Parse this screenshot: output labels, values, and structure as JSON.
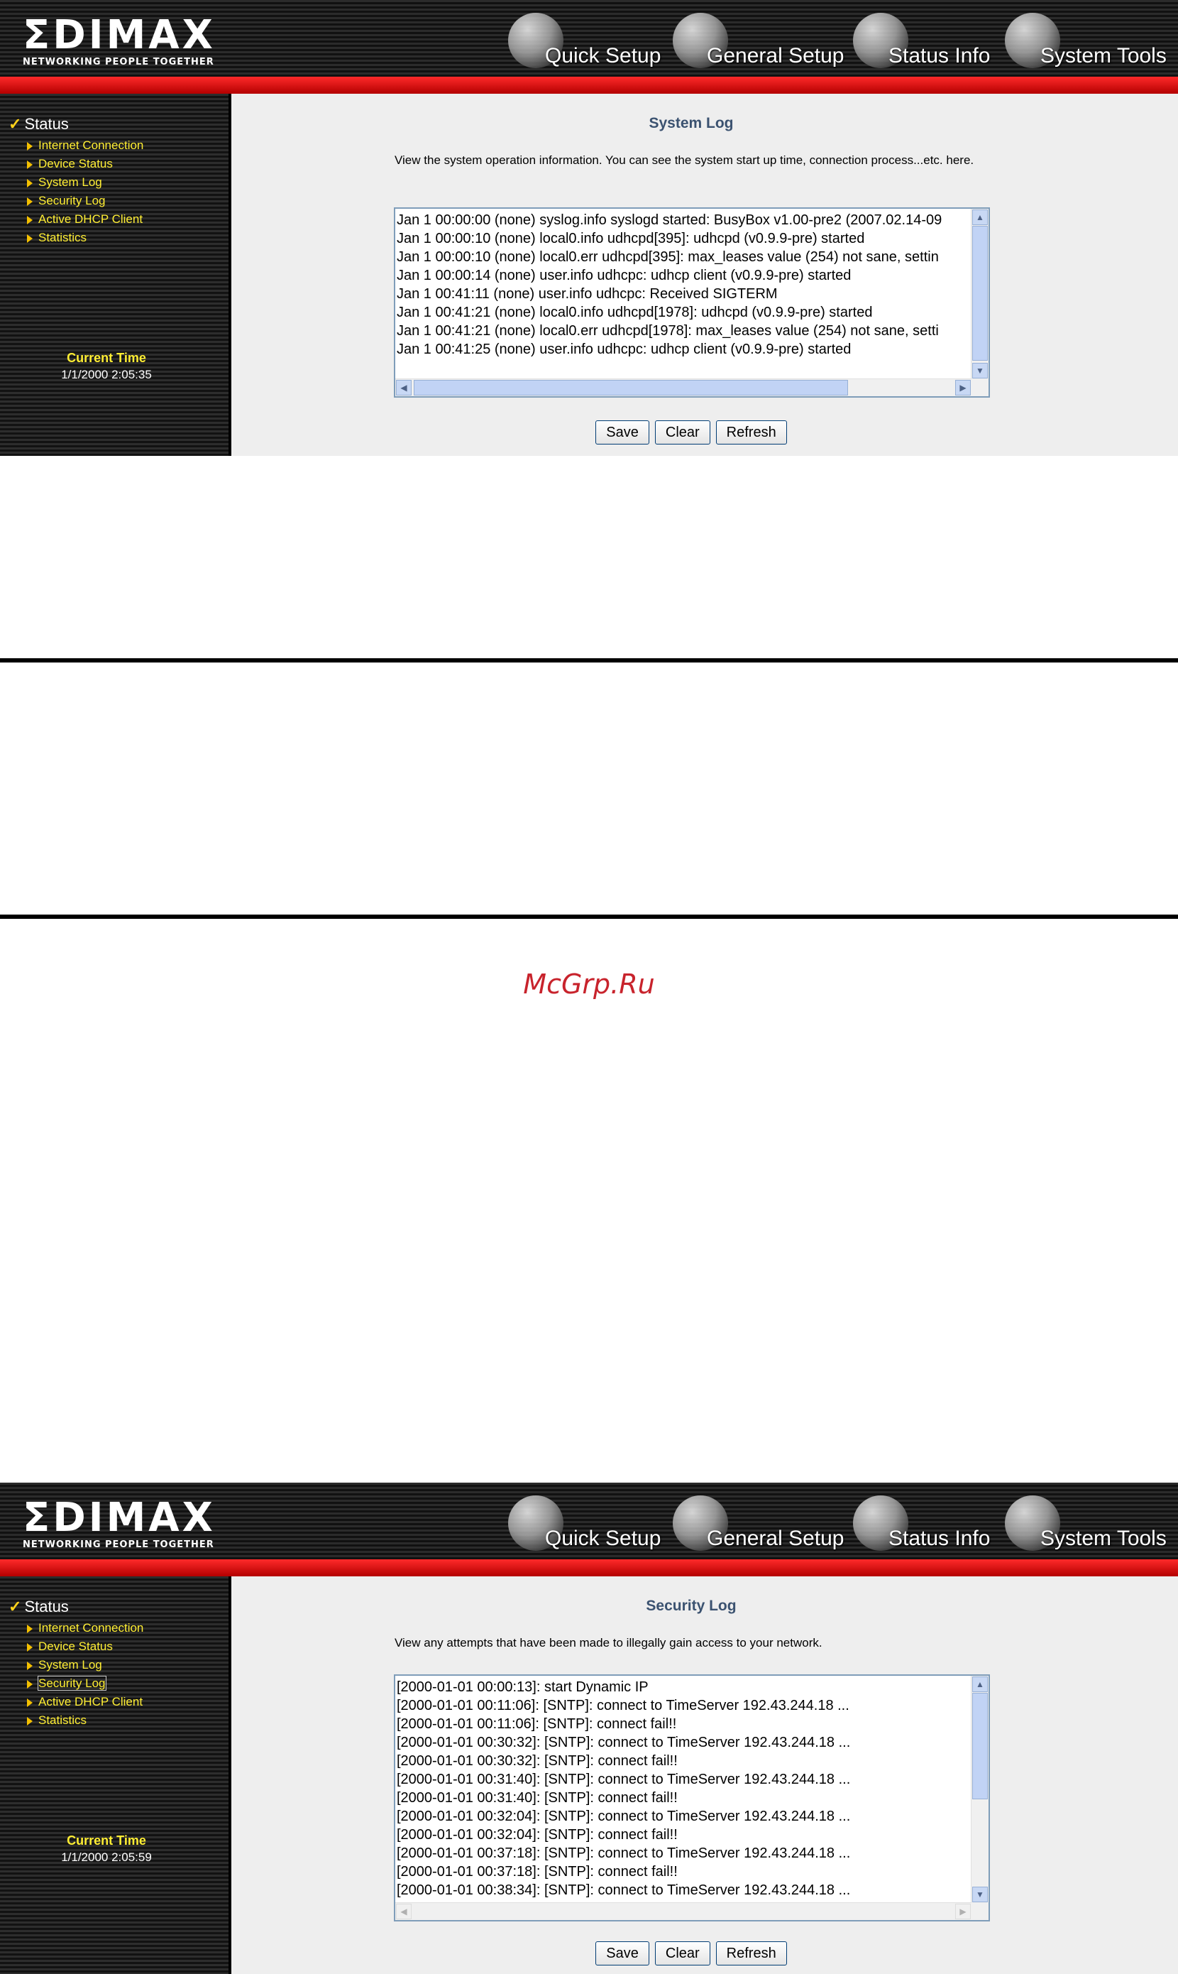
{
  "brand": {
    "name": "ΣDIMAX",
    "tagline": "NETWORKING PEOPLE TOGETHER"
  },
  "nav": [
    "Quick Setup",
    "General Setup",
    "Status Info",
    "System Tools"
  ],
  "sidebar": {
    "heading": "Status",
    "items": [
      "Internet Connection",
      "Device Status",
      "System Log",
      "Security Log",
      "Active DHCP Client",
      "Statistics"
    ],
    "time_label": "Current Time"
  },
  "buttons": {
    "save": "Save",
    "clear": "Clear",
    "refresh": "Refresh"
  },
  "system_log": {
    "current_time": "1/1/2000 2:05:35",
    "title": "System Log",
    "description": "View the system operation information. You can see the system start up time, connection process...etc. here.",
    "lines": [
      "Jan  1 00:00:00 (none) syslog.info syslogd started: BusyBox v1.00-pre2 (2007.02.14-09",
      "Jan  1 00:00:10 (none) local0.info udhcpd[395]: udhcpd (v0.9.9-pre) started",
      "Jan  1 00:00:10 (none) local0.err udhcpd[395]: max_leases value (254) not sane, settin",
      "Jan  1 00:00:14 (none) user.info udhcpc: udhcp client (v0.9.9-pre) started",
      "Jan  1 00:41:11 (none) user.info udhcpc: Received SIGTERM",
      "Jan  1 00:41:21 (none) local0.info udhcpd[1978]: udhcpd (v0.9.9-pre) started",
      "Jan  1 00:41:21 (none) local0.err udhcpd[1978]: max_leases value (254) not sane, setti",
      "Jan  1 00:41:25 (none) user.info udhcpc: udhcp client (v0.9.9-pre) started"
    ]
  },
  "security_log": {
    "current_time": "1/1/2000 2:05:59",
    "title": "Security Log",
    "description": "View any attempts that have been made to illegally gain access to your network.",
    "lines": [
      "[2000-01-01 00:00:13]: start Dynamic IP",
      "[2000-01-01 00:11:06]: [SNTP]: connect to TimeServer 192.43.244.18 ...",
      "[2000-01-01 00:11:06]: [SNTP]: connect fail!!",
      "[2000-01-01 00:30:32]: [SNTP]: connect to TimeServer 192.43.244.18 ...",
      "[2000-01-01 00:30:32]: [SNTP]: connect fail!!",
      "[2000-01-01 00:31:40]: [SNTP]: connect to TimeServer 192.43.244.18 ...",
      "[2000-01-01 00:31:40]: [SNTP]: connect fail!!",
      "[2000-01-01 00:32:04]: [SNTP]: connect to TimeServer 192.43.244.18 ...",
      "[2000-01-01 00:32:04]: [SNTP]: connect fail!!",
      "[2000-01-01 00:37:18]: [SNTP]: connect to TimeServer 192.43.244.18 ...",
      "[2000-01-01 00:37:18]: [SNTP]: connect fail!!",
      "[2000-01-01 00:38:34]: [SNTP]: connect to TimeServer 192.43.244.18 ..."
    ]
  },
  "watermark": "McGrp.Ru"
}
